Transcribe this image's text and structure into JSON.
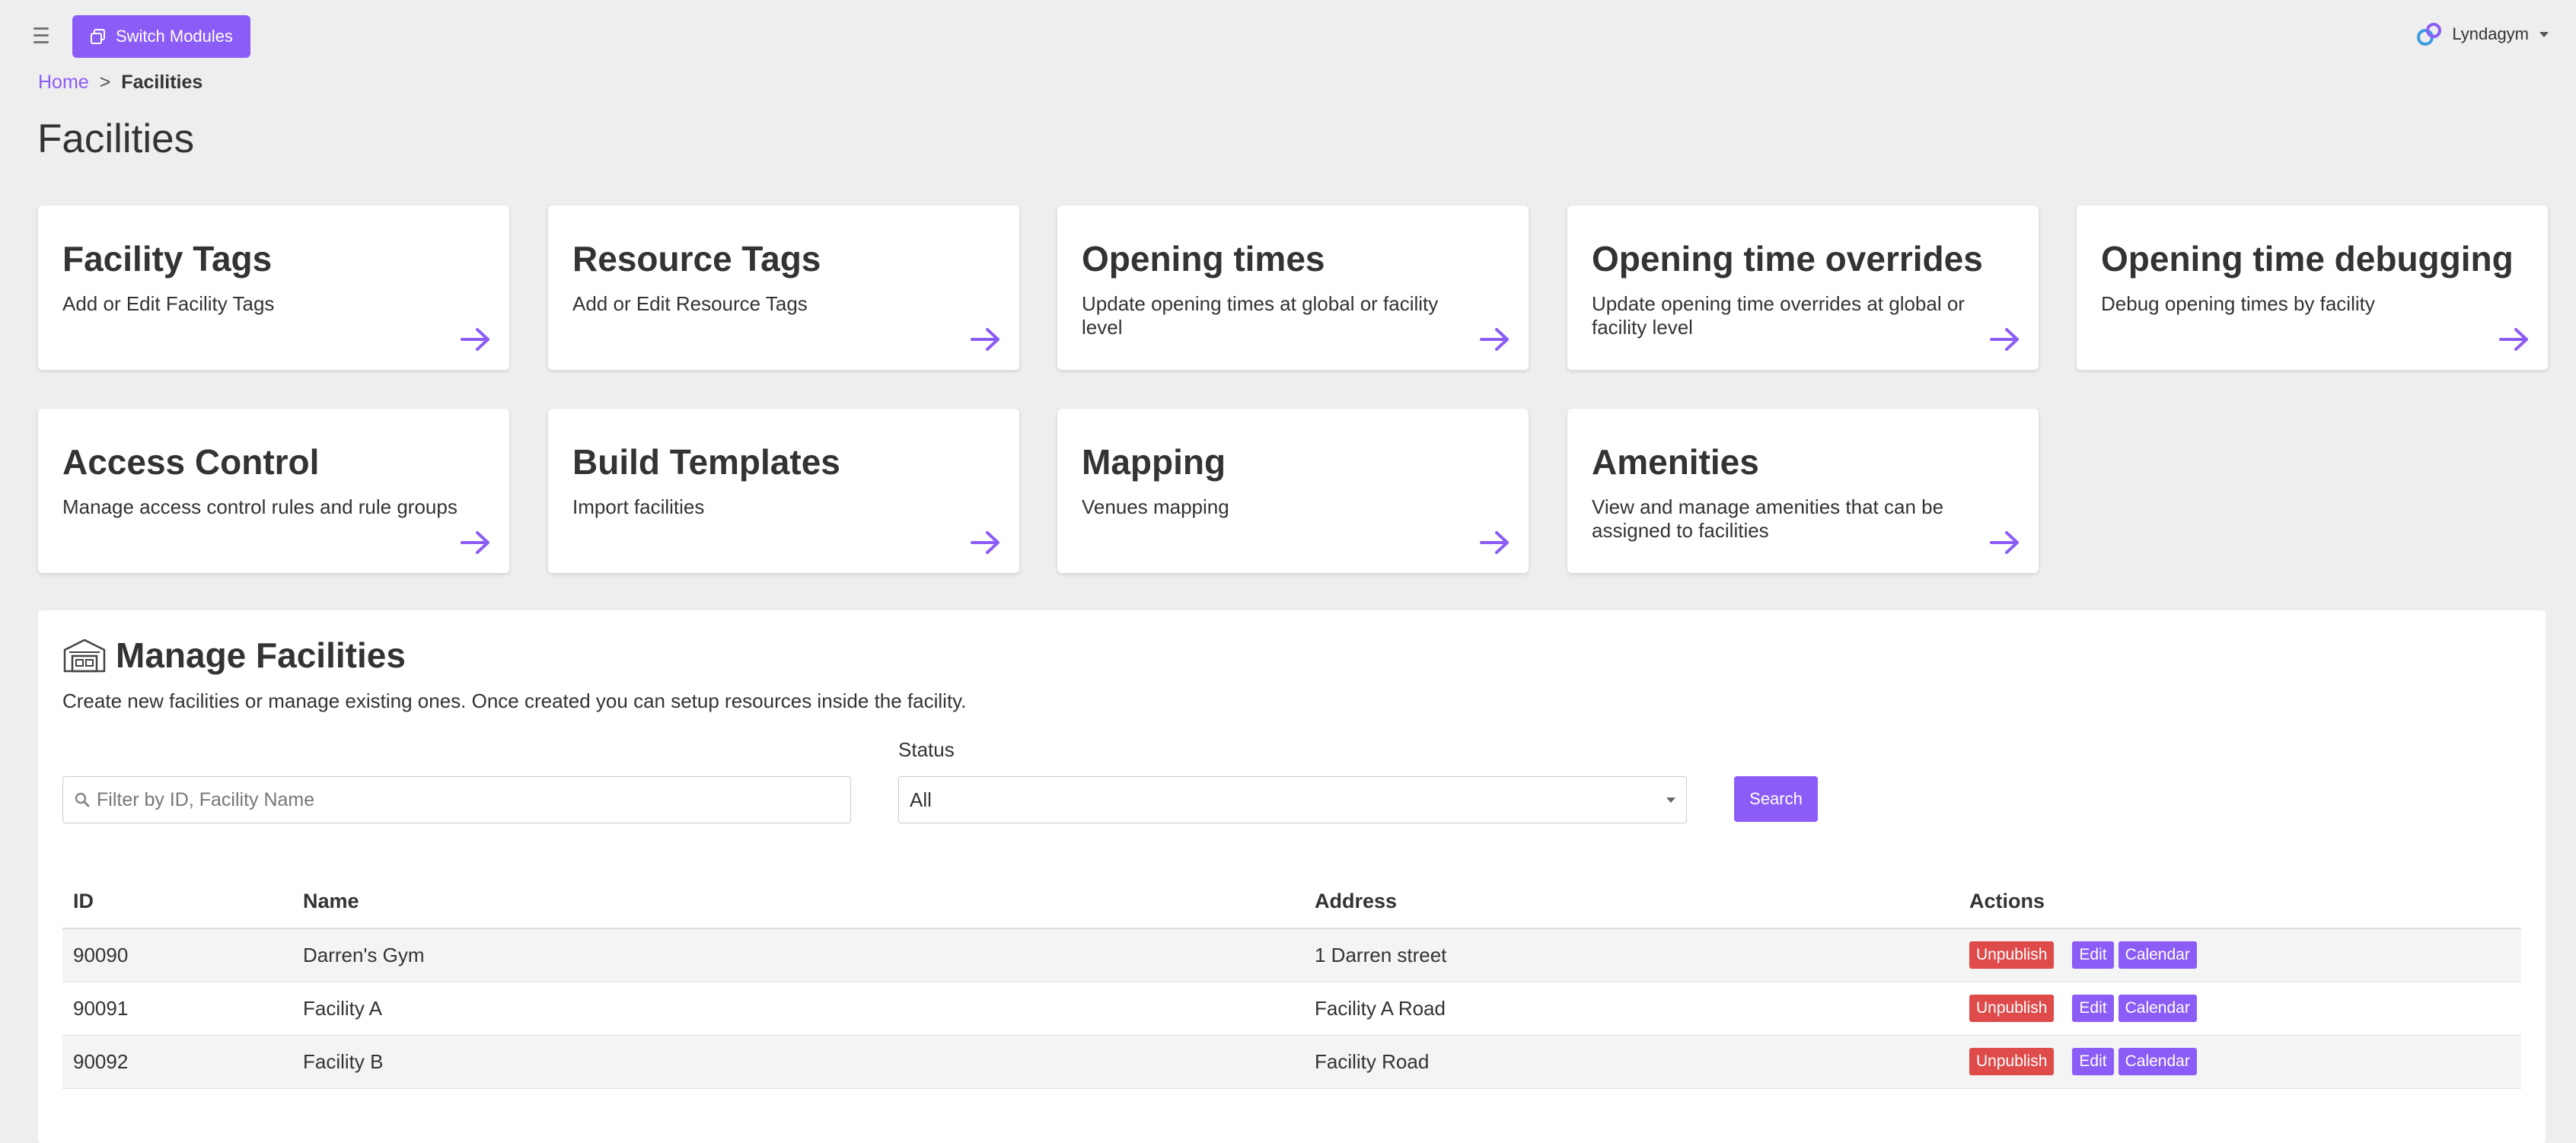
{
  "header": {
    "switch_modules_label": "Switch Modules",
    "user_name": "Lyndagym"
  },
  "breadcrumb": {
    "home": "Home",
    "separator": ">",
    "current": "Facilities"
  },
  "page_title": "Facilities",
  "cards": [
    {
      "title": "Facility Tags",
      "desc": "Add or Edit Facility Tags"
    },
    {
      "title": "Resource Tags",
      "desc": "Add or Edit Resource Tags"
    },
    {
      "title": "Opening times",
      "desc": "Update opening times at global or facility level"
    },
    {
      "title": "Opening time overrides",
      "desc": "Update opening time overrides at global or facility level"
    },
    {
      "title": "Opening time debugging",
      "desc": "Debug opening times by facility"
    },
    {
      "title": "Access Control",
      "desc": "Manage access control rules and rule groups"
    },
    {
      "title": "Build Templates",
      "desc": "Import facilities"
    },
    {
      "title": "Mapping",
      "desc": "Venues mapping"
    },
    {
      "title": "Amenities",
      "desc": "View and manage amenities that can be assigned to facilities"
    }
  ],
  "manage": {
    "title": "Manage Facilities",
    "description": "Create new facilities or manage existing ones. Once created you can setup resources inside the facility.",
    "filter_placeholder": "Filter by ID, Facility Name",
    "status_label": "Status",
    "status_value": "All",
    "search_label": "Search"
  },
  "table": {
    "columns": [
      "ID",
      "Name",
      "Address",
      "Actions"
    ],
    "rows": [
      {
        "id": "90090",
        "name": "Darren's Gym",
        "address": "1 Darren street"
      },
      {
        "id": "90091",
        "name": "Facility A",
        "address": "Facility A Road"
      },
      {
        "id": "90092",
        "name": "Facility B",
        "address": "Facility Road"
      }
    ],
    "actions": {
      "unpublish": "Unpublish",
      "edit": "Edit",
      "calendar": "Calendar"
    }
  },
  "colors": {
    "accent": "#8b5cf6",
    "danger": "#df4b4b",
    "background": "#eeeeee"
  },
  "icons": {
    "menu": "hamburger-icon",
    "switch": "windows-icon",
    "user_logo": "lyndagym-logo-icon",
    "card_arrow": "arrow-right-icon",
    "manage": "facility-building-icon",
    "search": "search-icon"
  }
}
